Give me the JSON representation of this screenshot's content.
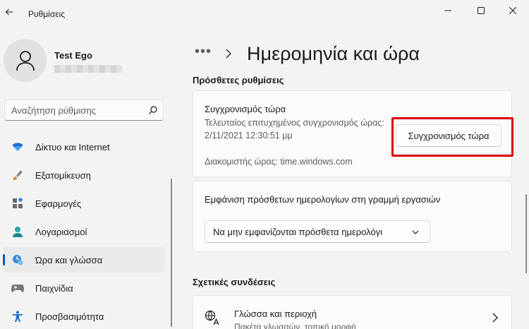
{
  "app": {
    "title": "Ρυθμίσεις"
  },
  "user": {
    "name": "Test Ego"
  },
  "search": {
    "placeholder": "Αναζήτηση ρύθμισης"
  },
  "nav": {
    "items": [
      {
        "label": "Δίκτυο και Internet",
        "icon": "wifi-icon"
      },
      {
        "label": "Εξατομίκευση",
        "icon": "brush-icon"
      },
      {
        "label": "Εφαρμογές",
        "icon": "apps-icon"
      },
      {
        "label": "Λογαριασμοί",
        "icon": "person-icon"
      },
      {
        "label": "Ώρα και γλώσσα",
        "icon": "clock-globe-icon",
        "active": true
      },
      {
        "label": "Παιχνίδια",
        "icon": "gamepad-icon"
      },
      {
        "label": "Προσβασιμότητα",
        "icon": "accessibility-icon"
      }
    ]
  },
  "page": {
    "breadcrumb_more": "•••",
    "title": "Ημερομηνία και ώρα"
  },
  "additional": {
    "heading": "Πρόσθετες ρυθμίσεις",
    "sync": {
      "title": "Συγχρονισμός τώρα",
      "detail": "Τελευταίος επιτυχημένος συγχρονισμός ώρας: 2/11/2021 12:30:51 μμ",
      "server": "Διακομιστής ώρας: time.windows.com",
      "button_label": "Συγχρονισμός τώρα"
    },
    "calendars": {
      "label": "Εμφάνιση πρόσθετων ημερολογίων στη γραμμή εργασιών",
      "selected": "Να μην εμφανίζονται πρόσθετα ημερολόγι"
    }
  },
  "related": {
    "heading": "Σχετικές συνδέσεις",
    "link": {
      "title": "Γλώσσα και περιοχή",
      "subtitle": "Πακέτα γλωσσών, τοπική μορφή"
    }
  },
  "colors": {
    "accent": "#005fb8",
    "highlight_border": "#d9000d",
    "background": "#f3f3f3",
    "card": "#fbfbfb"
  }
}
